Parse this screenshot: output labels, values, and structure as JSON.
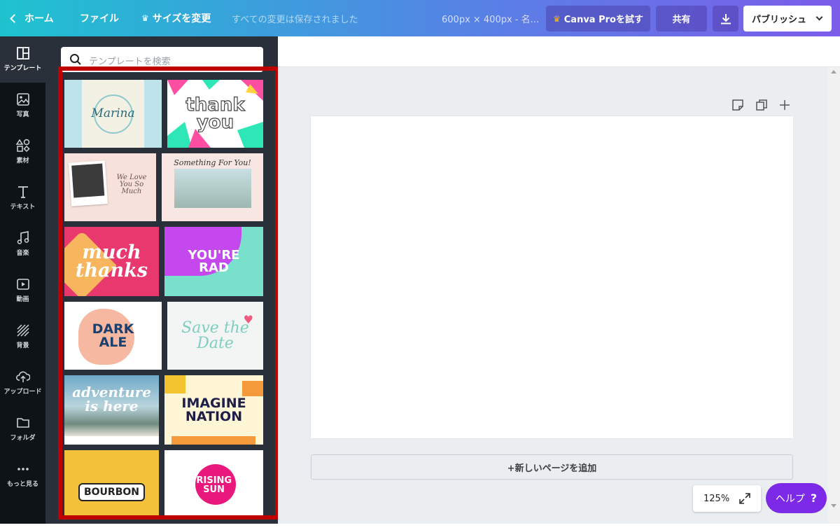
{
  "topbar": {
    "home_label": "ホーム",
    "file_label": "ファイル",
    "resize_label": "サイズを変更",
    "saved_status": "すべての変更は保存されました",
    "doc_title": "600px × 400px - 名...",
    "pro_label": "Canva Proを試す",
    "share_label": "共有",
    "publish_label": "パブリッシュ",
    "colors": {
      "gradient_start": "#1ec3cf",
      "gradient_end": "#7b5de9"
    }
  },
  "rail": {
    "items": [
      {
        "label": "テンプレート",
        "icon": "template-icon",
        "active": true
      },
      {
        "label": "写真",
        "icon": "photo-icon"
      },
      {
        "label": "素材",
        "icon": "elements-icon"
      },
      {
        "label": "テキスト",
        "icon": "text-icon"
      },
      {
        "label": "音楽",
        "icon": "music-icon"
      },
      {
        "label": "動画",
        "icon": "video-icon"
      },
      {
        "label": "背景",
        "icon": "background-icon"
      },
      {
        "label": "アップロード",
        "icon": "upload-icon"
      },
      {
        "label": "フォルダ",
        "icon": "folder-icon"
      },
      {
        "label": "もっと見る",
        "icon": "more-icon"
      }
    ]
  },
  "panel": {
    "search_placeholder": "テンプレートを検索",
    "templates": [
      {
        "name": "marina",
        "text": "Marina"
      },
      {
        "name": "thank-you",
        "text": "thank you"
      },
      {
        "name": "we-love-you",
        "text": "We Love You So Much"
      },
      {
        "name": "something-for-you",
        "text": "Something For You!"
      },
      {
        "name": "much-thanks",
        "text": "much thanks"
      },
      {
        "name": "youre-rad",
        "text": "YOU'RE RAD"
      },
      {
        "name": "dark-ale",
        "text": "DARK ALE"
      },
      {
        "name": "save-the-date",
        "text": "Save the Date"
      },
      {
        "name": "adventure",
        "text": "adventure is here"
      },
      {
        "name": "imagine-nation",
        "text": "IMAGINE NATION"
      },
      {
        "name": "bourbon",
        "text": "BOURBON"
      },
      {
        "name": "rising-sun",
        "text": "RISING SUN"
      }
    ]
  },
  "canvas": {
    "add_page_label": "+新しいページを追加",
    "zoom_level": "125%",
    "help_label": "ヘルプ",
    "help_symbol": "?"
  }
}
